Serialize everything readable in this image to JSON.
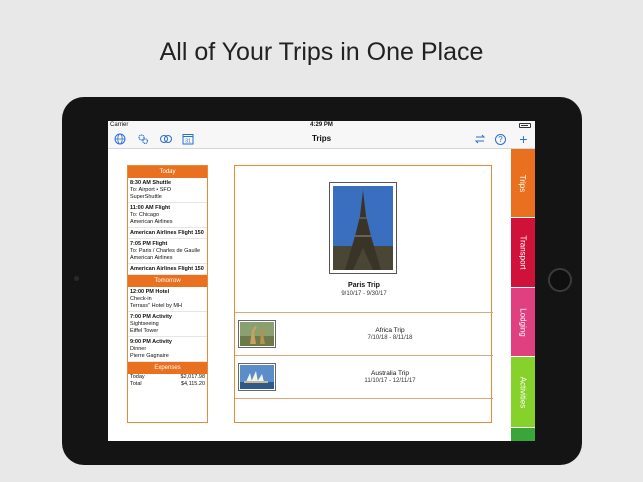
{
  "headline": "All of Your Trips in One Place",
  "status": {
    "carrier": "Carrier",
    "time": "4:29 PM"
  },
  "nav": {
    "title": "Trips",
    "left_icons": [
      "globe-icon",
      "gear-icon",
      "currency-icon",
      "calendar-icon"
    ],
    "calendar_day": "31",
    "right_icons": [
      "sync-icon",
      "help-icon",
      "add-icon"
    ],
    "help_label": "?",
    "add_label": "+"
  },
  "agenda": {
    "today_header": "Today",
    "today_items": [
      {
        "title": "8:30 AM  Shuttle",
        "lines": [
          "To: Airport • SFO",
          "SuperShuttle"
        ]
      },
      {
        "title": "11:00 AM  Flight",
        "lines": [
          "To: Chicago",
          "American Airlines"
        ]
      },
      {
        "single": "American Airlines Flight 150"
      },
      {
        "title": "7:05 PM  Flight",
        "lines": [
          "To: Paris / Charles de Gaulle",
          "American Airlines"
        ]
      },
      {
        "single": "American Airlines Flight 150"
      }
    ],
    "tomorrow_header": "Tomorrow",
    "tomorrow_items": [
      {
        "title": "12:00 PM  Hotel",
        "lines": [
          "Check-in",
          "Terrass'' Hotel by MH"
        ]
      },
      {
        "title": "7:00 PM  Activity",
        "lines": [
          "Sightseeing",
          "Eiffel Tower"
        ]
      },
      {
        "title": "9:00 PM  Activity",
        "lines": [
          "Dinner",
          "Pierre Gagnaire"
        ]
      }
    ],
    "expenses_header": "Expenses",
    "expenses": [
      {
        "label": "Today",
        "amount": "$2,017.98"
      },
      {
        "label": "Total",
        "amount": "$4,115.20"
      }
    ]
  },
  "featured_trip": {
    "name": "Paris Trip",
    "dates": "9/10/17 - 9/30/17"
  },
  "trips": [
    {
      "name": "Africa Trip",
      "dates": "7/10/18 - 8/11/18",
      "thumb": "giraffe-photo"
    },
    {
      "name": "Australia Trip",
      "dates": "11/10/17 - 12/11/17",
      "thumb": "opera-house-photo"
    }
  ],
  "tabs": [
    {
      "label": "Trips",
      "color": "#e8701f"
    },
    {
      "label": "Transport",
      "color": "#d0123a"
    },
    {
      "label": "Lodging",
      "color": "#e0407f"
    },
    {
      "label": "Activities",
      "color": "#86d12a"
    }
  ],
  "tab_extra_color": "#3aa63a"
}
